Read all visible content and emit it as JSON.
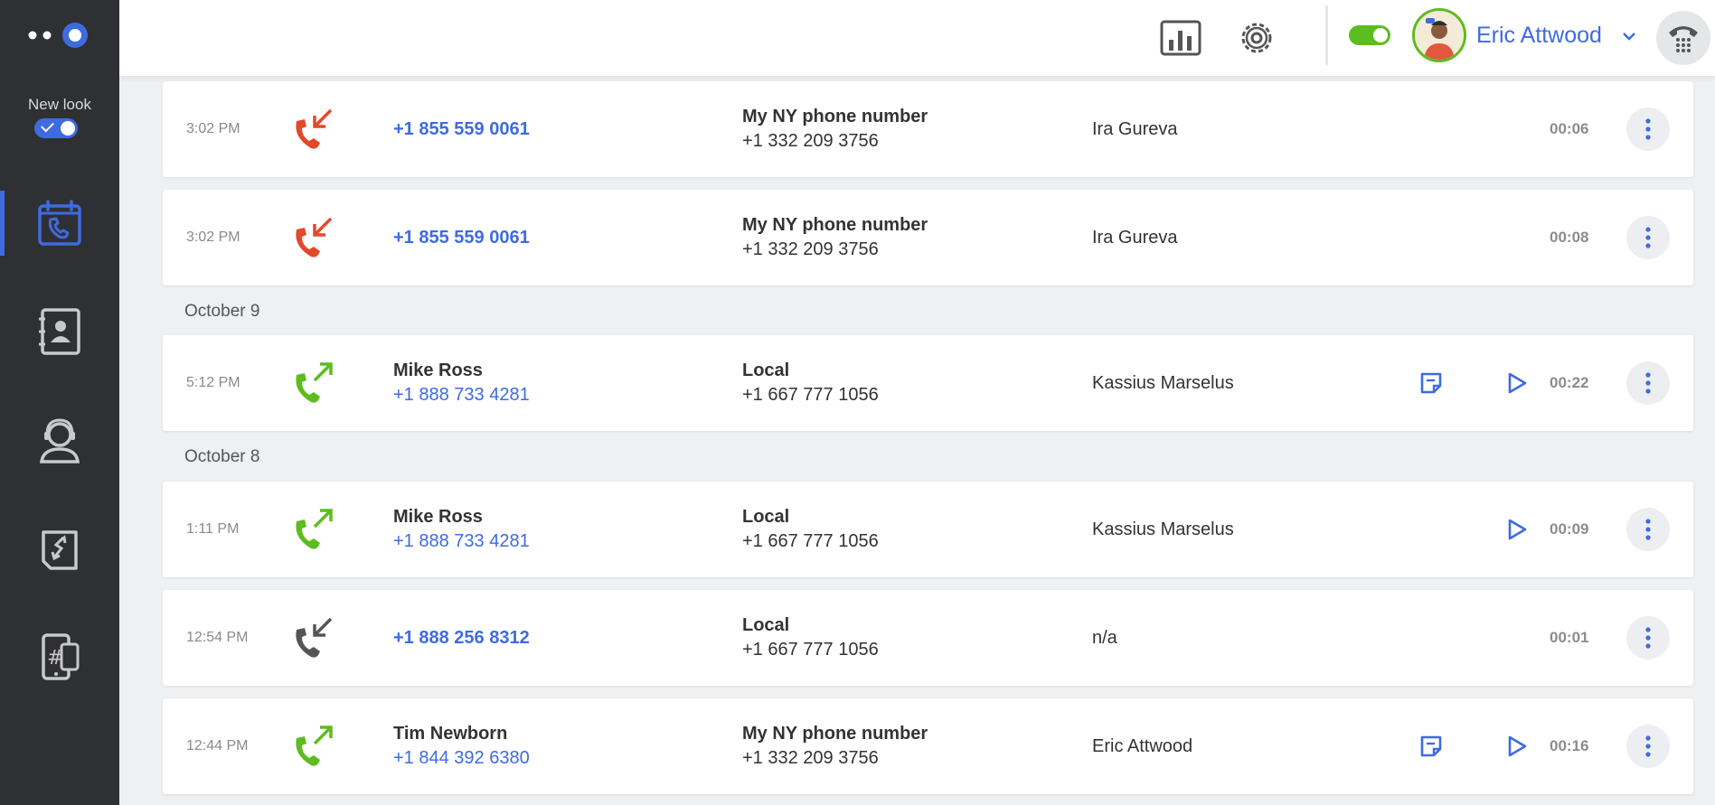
{
  "sidebar": {
    "logo": "app-logo",
    "new_look_label": "New look",
    "new_look_enabled": true,
    "items": [
      {
        "name": "calls",
        "icon": "calendar-phone-icon",
        "active": true
      },
      {
        "name": "contacts",
        "icon": "contacts-book-icon",
        "active": false
      },
      {
        "name": "agents",
        "icon": "headset-agent-icon",
        "active": false
      },
      {
        "name": "call-flows",
        "icon": "call-flow-icon",
        "active": false
      },
      {
        "name": "numbers",
        "icon": "phone-number-icon",
        "active": false
      }
    ]
  },
  "header": {
    "analytics_icon": "bar-chart-icon",
    "settings_icon": "gear-icon",
    "available": true,
    "user_name": "Eric Attwood",
    "dialpad_icon": "dialpad-icon"
  },
  "colors": {
    "accent": "#3f6be0",
    "missed": "#e2492b",
    "outgoing": "#5cbd1e",
    "unanswered": "#555555",
    "sidebar": "#2f3033"
  },
  "calls": [
    {
      "time": "3:02 PM",
      "direction": "missed-incoming",
      "caller_name": "",
      "caller_number": "+1 855 559 0061",
      "line_name": "My NY phone number",
      "line_number": "+1 332 209 3756",
      "agent": "Ira Gureva",
      "has_note": false,
      "has_recording": false,
      "duration": "00:06"
    },
    {
      "time": "3:02 PM",
      "direction": "missed-incoming",
      "caller_name": "",
      "caller_number": "+1 855 559 0061",
      "line_name": "My NY phone number",
      "line_number": "+1 332 209 3756",
      "agent": "Ira Gureva",
      "has_note": false,
      "has_recording": false,
      "duration": "00:08"
    },
    {
      "date_label": "October 9",
      "time": "5:12 PM",
      "direction": "outgoing",
      "caller_name": "Mike Ross",
      "caller_number": "+1 888 733 4281",
      "line_name": "Local",
      "line_number": "+1 667 777 1056",
      "agent": "Kassius Marselus",
      "has_note": true,
      "has_recording": true,
      "duration": "00:22"
    },
    {
      "date_label": "October 8",
      "time": "1:11 PM",
      "direction": "outgoing",
      "caller_name": "Mike Ross",
      "caller_number": "+1 888 733 4281",
      "line_name": "Local",
      "line_number": "+1 667 777 1056",
      "agent": "Kassius Marselus",
      "has_note": false,
      "has_recording": true,
      "duration": "00:09"
    },
    {
      "time": "12:54 PM",
      "direction": "incoming",
      "caller_name": "",
      "caller_number": "+1 888 256 8312",
      "line_name": "Local",
      "line_number": "+1 667 777 1056",
      "agent": "n/a",
      "has_note": false,
      "has_recording": false,
      "duration": "00:01"
    },
    {
      "time": "12:44 PM",
      "direction": "outgoing",
      "caller_name": "Tim Newborn",
      "caller_number": "+1 844 392 6380",
      "line_name": "My NY phone number",
      "line_number": "+1 332 209 3756",
      "agent": "Eric Attwood",
      "has_note": true,
      "has_recording": true,
      "duration": "00:16"
    }
  ]
}
